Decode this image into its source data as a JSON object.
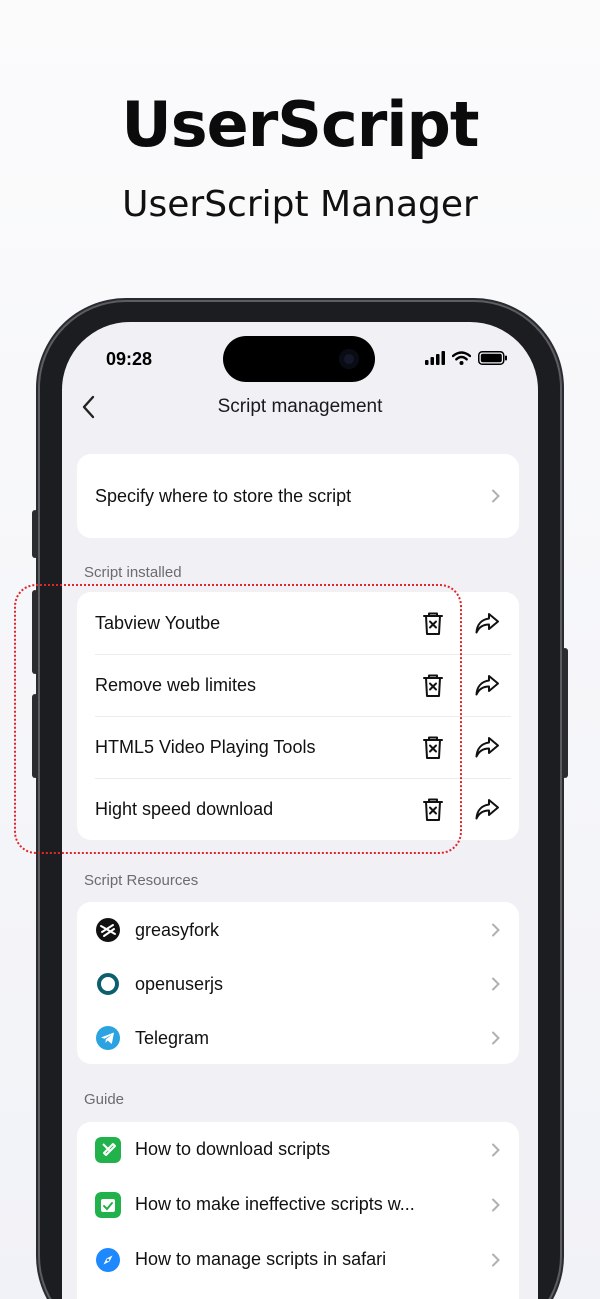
{
  "hero": {
    "title": "UserScript",
    "subtitle": "UserScript Manager"
  },
  "status_bar": {
    "time": "09:28"
  },
  "nav": {
    "title": "Script management"
  },
  "storage": {
    "label": "Specify where to store the script"
  },
  "installed": {
    "section_label": "Script installed",
    "items": [
      {
        "name": "Tabview Youtbe"
      },
      {
        "name": "Remove web limites"
      },
      {
        "name": "HTML5 Video Playing Tools"
      },
      {
        "name": "Hight speed download"
      }
    ]
  },
  "resources": {
    "section_label": "Script Resources",
    "items": [
      {
        "name": "greasyfork",
        "icon": "greasyfork-icon",
        "color": "#111111"
      },
      {
        "name": "openuserjs",
        "icon": "openuserjs-icon",
        "color": "#0d5f6e"
      },
      {
        "name": "Telegram",
        "icon": "telegram-icon",
        "color": "#2aa3e0"
      }
    ]
  },
  "guide": {
    "section_label": "Guide",
    "items": [
      {
        "name": "How to download scripts",
        "icon": "download-guide-icon",
        "color": "#22b24c"
      },
      {
        "name": "How to make ineffective scripts w...",
        "icon": "fix-guide-icon",
        "color": "#22b24c"
      },
      {
        "name": "How to manage scripts in safari",
        "icon": "safari-icon",
        "color": "#1e88ff"
      }
    ]
  },
  "colors": {
    "highlight": "#e0262b",
    "background": "#f1f1f5"
  }
}
